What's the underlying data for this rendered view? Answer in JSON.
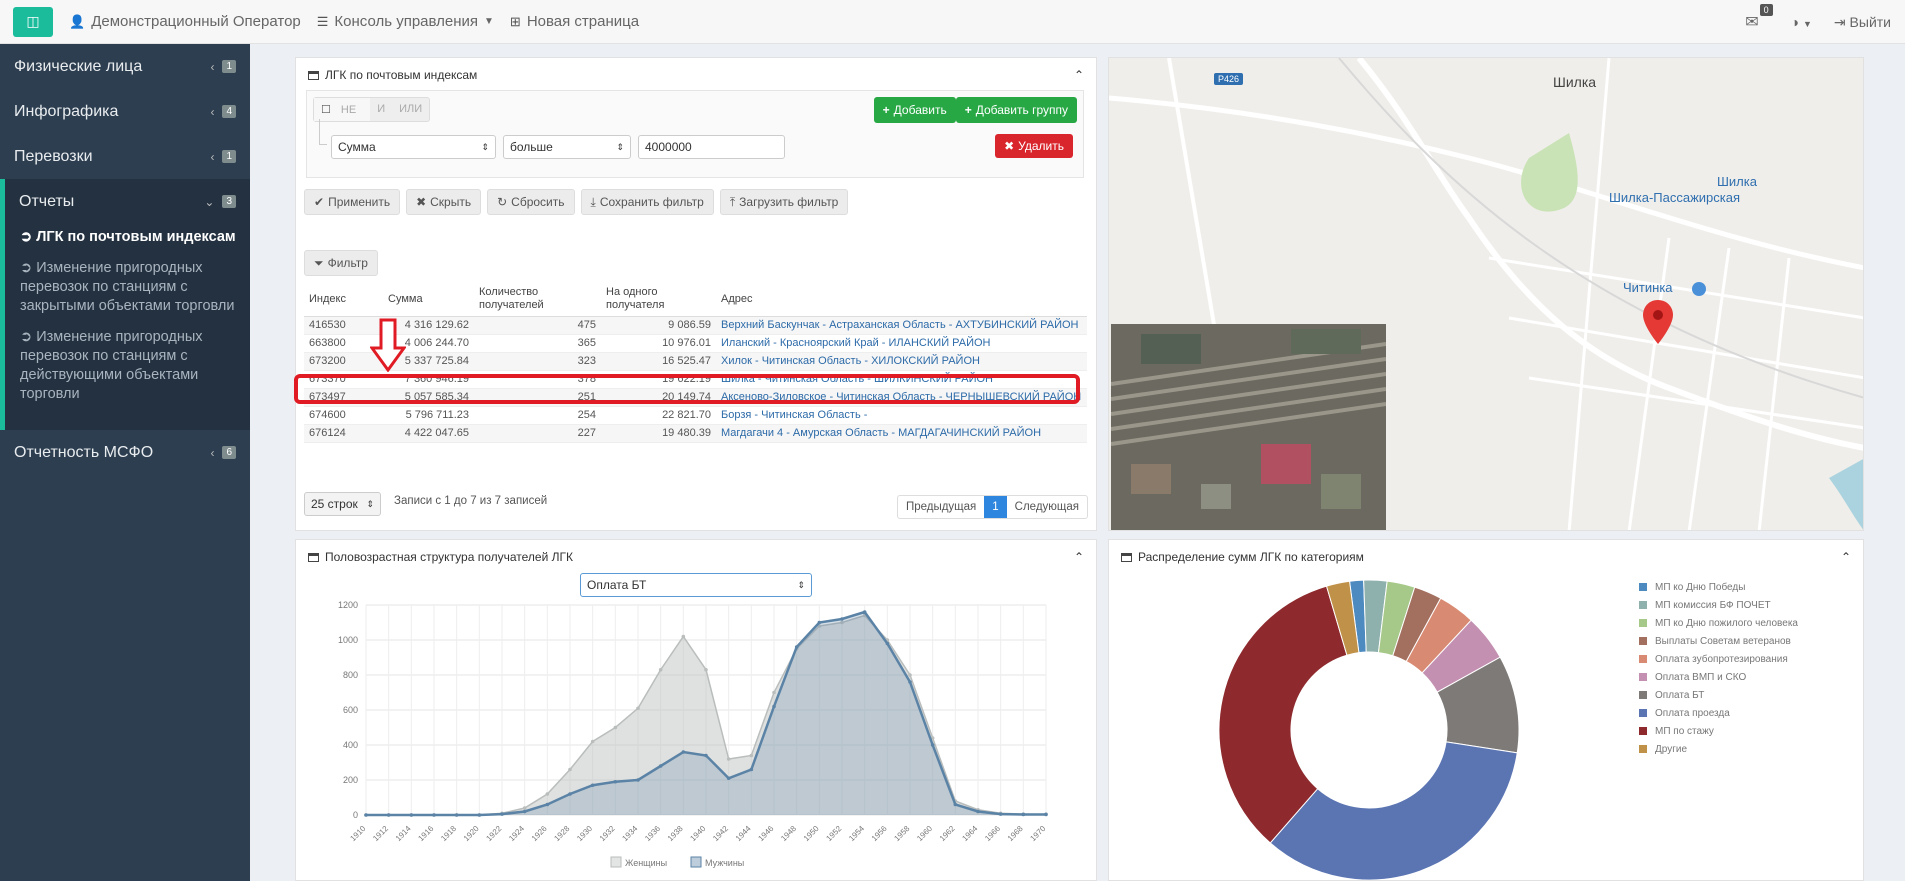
{
  "topbar": {
    "toggle_icon": "sidebar-toggle-icon",
    "user_label": "Демонстрационный Оператор",
    "console_label": "Консоль управления",
    "new_page_label": "Новая страница",
    "mail_count": "0",
    "logout_label": "Выйти"
  },
  "sidebar": {
    "items": [
      {
        "label": "Физические лица",
        "count": "1"
      },
      {
        "label": "Инфографика",
        "count": "4"
      },
      {
        "label": "Перевозки",
        "count": "1"
      },
      {
        "label": "Отчеты",
        "count": "3"
      },
      {
        "label": "Отчетность МСФО",
        "count": "6"
      }
    ],
    "sub_items": [
      "ЛГК по почтовым индексам",
      "Изменение пригородных перевозок по станциям с закрытыми объектами торговли",
      "Изменение пригородных перевозок по станциям с действующими объектами торговли"
    ]
  },
  "table_panel": {
    "title": "ЛГК по почтовым индексам",
    "seg": [
      "НЕ",
      "И",
      "ИЛИ"
    ],
    "add_label": "Добавить",
    "add_group_label": "Добавить группу",
    "field_value": "Сумма",
    "op_value": "больше",
    "input_value": "4000000",
    "delete_label": "Удалить",
    "apply_label": "Применить",
    "hide_label": "Скрыть",
    "reset_label": "Сбросить",
    "save_label": "Сохранить фильтр",
    "load_label": "Загрузить фильтр",
    "filter_label": "Фильтр",
    "columns": [
      "Индекс",
      "Сумма",
      "Количество получателей",
      "На одного получателя",
      "Адрес"
    ],
    "rows": [
      [
        "416530",
        "4 316 129.62",
        "475",
        "9 086.59",
        "Верхний Баскунчак - Астраханская Область - АХТУБИНСКИЙ РАЙОН"
      ],
      [
        "663800",
        "4 006 244.70",
        "365",
        "10 976.01",
        "Иланский - Красноярский Край - ИЛАНСКИЙ РАЙОН"
      ],
      [
        "673200",
        "5 337 725.84",
        "323",
        "16 525.47",
        "Хилок - Читинская Область - ХИЛОКСКИЙ РАЙОН"
      ],
      [
        "673370",
        "7 360 946.19",
        "378",
        "19 622.19",
        "Шилка - Читинская Область - ШИЛКИНСКИЙ РАЙОН"
      ],
      [
        "673497",
        "5 057 585.34",
        "251",
        "20 149.74",
        "Аксеново-Зиловское - Читинская Область - ЧЕРНЫШЕВСКИЙ РАЙОН"
      ],
      [
        "674600",
        "5 796 711.23",
        "254",
        "22 821.70",
        "Борзя - Читинская Область -"
      ],
      [
        "676124",
        "4 422 047.65",
        "227",
        "19 480.39",
        "Магдагачи 4 - Амурская Область - МАГДАГАЧИНСКИЙ РАЙОН"
      ]
    ],
    "page_len": "25 строк",
    "info": "Записи с 1 до 7 из 7 записей",
    "prev_label": "Предыдущая",
    "page_num": "1",
    "next_label": "Следующая"
  },
  "map": {
    "road_label": "Р426",
    "town1": "Шилка",
    "station1": "Шилка",
    "station2": "Шилка-Пассажирская",
    "place": "Читинка"
  },
  "age_panel": {
    "title": "Половозрастная структура получателей ЛГК",
    "select_value": "Оплата БТ"
  },
  "chart_data": [
    {
      "type": "area",
      "title": "",
      "ylim": [
        0,
        1200
      ],
      "yticks": [
        0,
        200,
        400,
        600,
        800,
        1000,
        1200
      ],
      "x": [
        "1910",
        "1912",
        "1914",
        "1916",
        "1918",
        "1920",
        "1922",
        "1924",
        "1926",
        "1928",
        "1930",
        "1932",
        "1934",
        "1936",
        "1938",
        "1940",
        "1942",
        "1944",
        "1946",
        "1948",
        "1950",
        "1952",
        "1954",
        "1956",
        "1958",
        "1960",
        "1962",
        "1964",
        "1966",
        "1968",
        "1970"
      ],
      "series": [
        {
          "name": "Женщины",
          "color": "#b9bdbc",
          "values": [
            0,
            0,
            0,
            0,
            0,
            0,
            10,
            40,
            120,
            260,
            420,
            500,
            610,
            830,
            1020,
            830,
            320,
            340,
            700,
            950,
            1080,
            1100,
            1140,
            1000,
            800,
            440,
            80,
            30,
            10,
            5,
            5
          ]
        },
        {
          "name": "Мужчины",
          "color": "#5b83a6",
          "values": [
            0,
            0,
            0,
            0,
            0,
            0,
            5,
            20,
            60,
            120,
            170,
            190,
            200,
            280,
            360,
            340,
            210,
            260,
            620,
            960,
            1100,
            1120,
            1160,
            980,
            760,
            400,
            60,
            20,
            5,
            3,
            3
          ]
        }
      ]
    },
    {
      "type": "pie",
      "title": "Распределение сумм ЛГК по категориям",
      "slices": [
        {
          "name": "МП ко Дню Победы",
          "value": 1.5,
          "color": "#4d8abf"
        },
        {
          "name": "МП комиссия БФ ПОЧЕТ",
          "value": 2.5,
          "color": "#8fb1ad"
        },
        {
          "name": "МП ко Дню пожилого человека",
          "value": 3,
          "color": "#a6c98a"
        },
        {
          "name": "Выплаты Советам ветеранов",
          "value": 3,
          "color": "#a3705f"
        },
        {
          "name": "Оплата зубопротезирования",
          "value": 4,
          "color": "#d98a72"
        },
        {
          "name": "Оплата ВМП и СКО",
          "value": 5,
          "color": "#c390b1"
        },
        {
          "name": "Оплата БТ",
          "value": 10.5,
          "color": "#7d7a78"
        },
        {
          "name": "Оплата проезда",
          "value": 34,
          "color": "#5b75b3"
        },
        {
          "name": "МП по стажу",
          "value": 34,
          "color": "#8e2a2d"
        },
        {
          "name": "Другие",
          "value": 2.5,
          "color": "#c09148"
        }
      ]
    }
  ]
}
